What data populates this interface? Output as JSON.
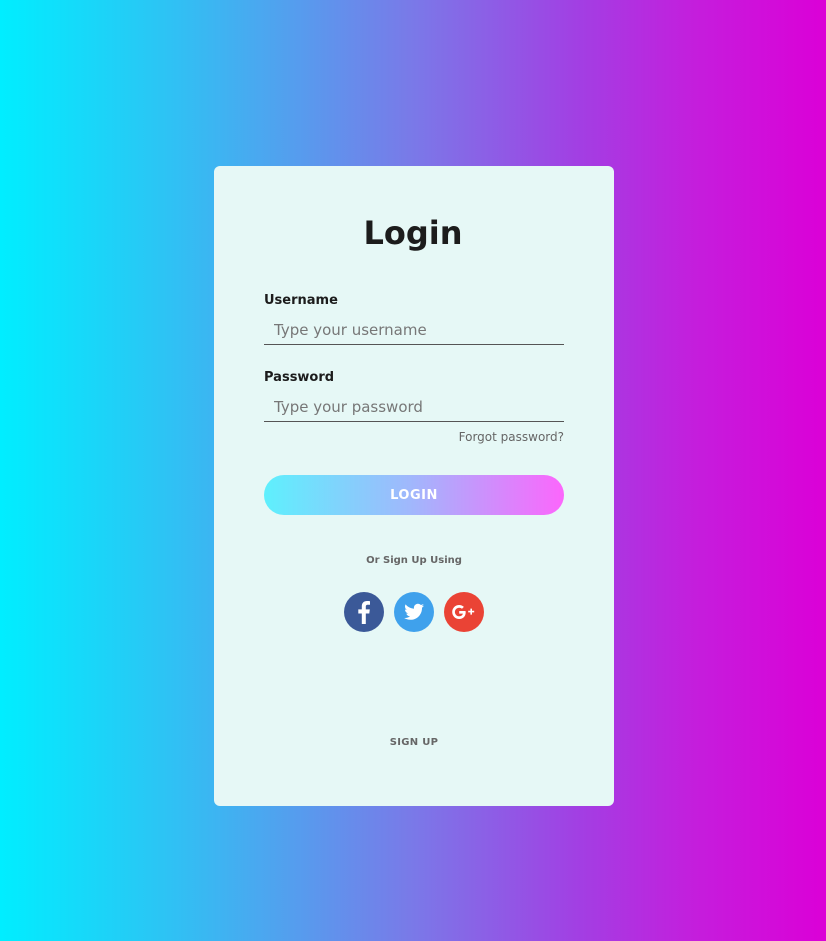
{
  "login_form": {
    "title": "Login",
    "username": {
      "label": "Username",
      "placeholder": "Type your username",
      "value": ""
    },
    "password": {
      "label": "Password",
      "placeholder": "Type your password",
      "value": ""
    },
    "forgot_password_label": "Forgot password?",
    "login_button_label": "LOGIN",
    "alt_signup_text": "Or Sign Up Using",
    "social_buttons": [
      {
        "icon": "facebook-icon",
        "color": "#3b5998"
      },
      {
        "icon": "twitter-icon",
        "color": "#3fa1ec"
      },
      {
        "icon": "google-plus-icon",
        "color": "#ea4335"
      }
    ],
    "signup_link_label": "SIGN UP"
  },
  "colors": {
    "background_left": "#00eeff",
    "background_right": "#db00d7",
    "card_background": "#e6f8f6",
    "button_gradient_left": "#5ef0fd",
    "button_gradient_right": "#fc66fc"
  }
}
